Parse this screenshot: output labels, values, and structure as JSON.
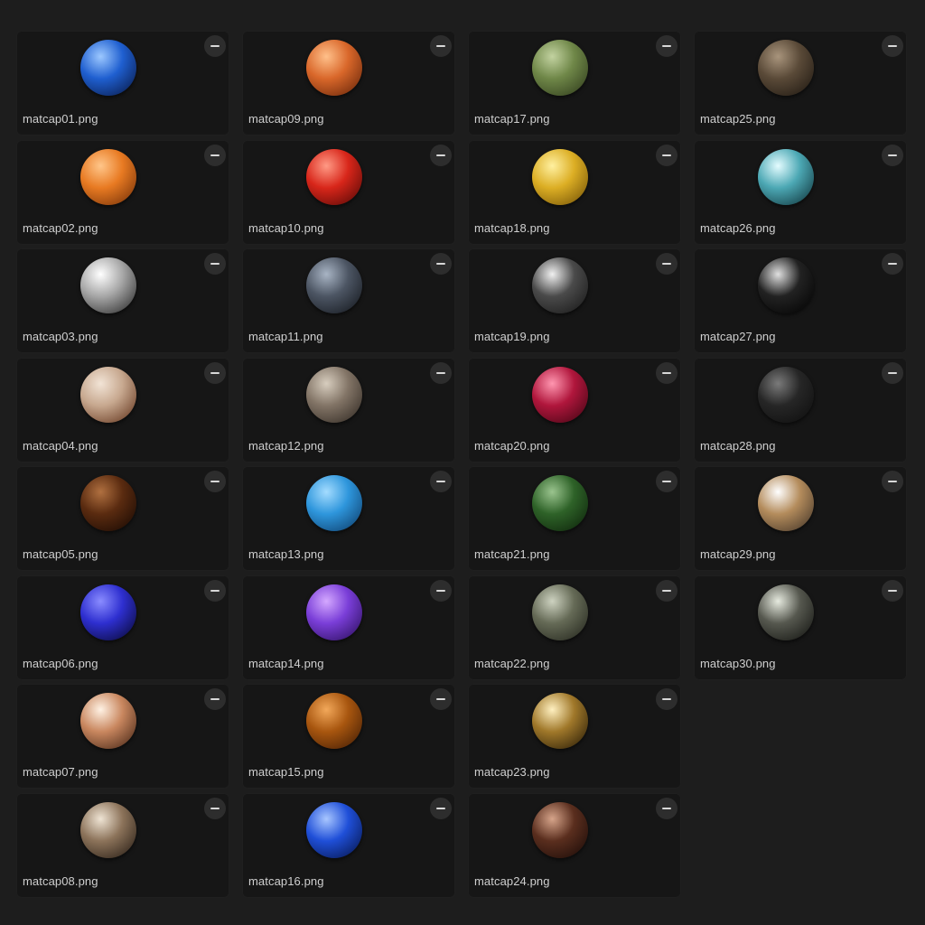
{
  "library": {
    "items": [
      {
        "name": "matcap01.png",
        "colors": [
          "#9cc8ff",
          "#1f5fd0",
          "#07133a"
        ]
      },
      {
        "name": "matcap02.png",
        "colors": [
          "#ffc68a",
          "#e87a22",
          "#6a2a06"
        ]
      },
      {
        "name": "matcap03.png",
        "colors": [
          "#ffffff",
          "#a7a7a7",
          "#1e1e1e"
        ]
      },
      {
        "name": "matcap04.png",
        "colors": [
          "#f2e4d6",
          "#c7a88f",
          "#5a2a12"
        ]
      },
      {
        "name": "matcap05.png",
        "colors": [
          "#b07040",
          "#5a2b10",
          "#120602"
        ]
      },
      {
        "name": "matcap06.png",
        "colors": [
          "#8a8cff",
          "#2e2fd0",
          "#050524"
        ]
      },
      {
        "name": "matcap07.png",
        "colors": [
          "#fff2e4",
          "#c9875f",
          "#3a1d0f"
        ]
      },
      {
        "name": "matcap08.png",
        "colors": [
          "#efe4d4",
          "#8c735a",
          "#1f160f"
        ]
      },
      {
        "name": "matcap09.png",
        "colors": [
          "#ffc08a",
          "#d9672a",
          "#5c1f06"
        ]
      },
      {
        "name": "matcap10.png",
        "colors": [
          "#ff9a85",
          "#d8261a",
          "#4a0604"
        ]
      },
      {
        "name": "matcap11.png",
        "colors": [
          "#a8b4c4",
          "#4c5563",
          "#0f1217"
        ]
      },
      {
        "name": "matcap12.png",
        "colors": [
          "#d7cdbe",
          "#827466",
          "#2a231d"
        ]
      },
      {
        "name": "matcap13.png",
        "colors": [
          "#a4dcff",
          "#2e96dc",
          "#0a3560"
        ]
      },
      {
        "name": "matcap14.png",
        "colors": [
          "#d4a8ff",
          "#7a3ed8",
          "#240a50"
        ]
      },
      {
        "name": "matcap15.png",
        "colors": [
          "#f2a85a",
          "#a8560f",
          "#3a1804"
        ]
      },
      {
        "name": "matcap16.png",
        "colors": [
          "#a8c6ff",
          "#1f4fd8",
          "#04103e"
        ]
      },
      {
        "name": "matcap17.png",
        "colors": [
          "#c2d2a0",
          "#6f8748",
          "#2a3518"
        ]
      },
      {
        "name": "matcap18.png",
        "colors": [
          "#fff0a0",
          "#dcae24",
          "#6a4a04"
        ]
      },
      {
        "name": "matcap19.png",
        "colors": [
          "#f0f0f0",
          "#4a4a4a",
          "#141414"
        ]
      },
      {
        "name": "matcap20.png",
        "colors": [
          "#ff96b0",
          "#b0163c",
          "#3a0410"
        ]
      },
      {
        "name": "matcap21.png",
        "colors": [
          "#9ac48e",
          "#2e6228",
          "#0a1e08"
        ]
      },
      {
        "name": "matcap22.png",
        "colors": [
          "#cdd2c0",
          "#656a56",
          "#1e2018"
        ]
      },
      {
        "name": "matcap23.png",
        "colors": [
          "#fff0c0",
          "#a0782a",
          "#1e1404"
        ]
      },
      {
        "name": "matcap24.png",
        "colors": [
          "#d6a48a",
          "#5a2e1e",
          "#150806"
        ]
      },
      {
        "name": "matcap25.png",
        "colors": [
          "#a8947c",
          "#5a4a38",
          "#1a140e"
        ]
      },
      {
        "name": "matcap26.png",
        "colors": [
          "#e4fcff",
          "#4ca8b4",
          "#0a2a30"
        ]
      },
      {
        "name": "matcap27.png",
        "colors": [
          "#e0e0e0",
          "#222222",
          "#000000"
        ]
      },
      {
        "name": "matcap28.png",
        "colors": [
          "#7a7a7a",
          "#262626",
          "#0c0c0c"
        ]
      },
      {
        "name": "matcap29.png",
        "colors": [
          "#ffffff",
          "#b48c5c",
          "#3a2e24"
        ]
      },
      {
        "name": "matcap30.png",
        "colors": [
          "#e6eadf",
          "#56584f",
          "#0e0f0c"
        ]
      }
    ]
  }
}
